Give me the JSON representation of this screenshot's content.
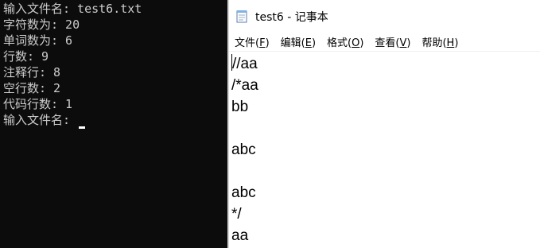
{
  "console": {
    "lines": [
      "输入文件名: test6.txt",
      "字符数为: 20",
      "单词数为: 6",
      "行数: 9",
      "注释行: 8",
      "空行数: 2",
      "代码行数: 1",
      "输入文件名: "
    ]
  },
  "notepad": {
    "title": "test6 - 记事本",
    "icon": "notepad-icon",
    "menu": [
      {
        "label": "文件(",
        "key": "F",
        "end": ")"
      },
      {
        "label": "编辑(",
        "key": "E",
        "end": ")"
      },
      {
        "label": "格式(",
        "key": "O",
        "end": ")"
      },
      {
        "label": "查看(",
        "key": "V",
        "end": ")"
      },
      {
        "label": "帮助(",
        "key": "H",
        "end": ")"
      }
    ],
    "content_lines": [
      "//aa",
      "/*aa",
      "bb",
      "",
      "abc",
      "",
      "abc",
      "*/",
      "aa"
    ]
  },
  "colors": {
    "console_bg": "#0c0c0c",
    "console_fg": "#cccccc",
    "notepad_bg": "#ffffff"
  }
}
